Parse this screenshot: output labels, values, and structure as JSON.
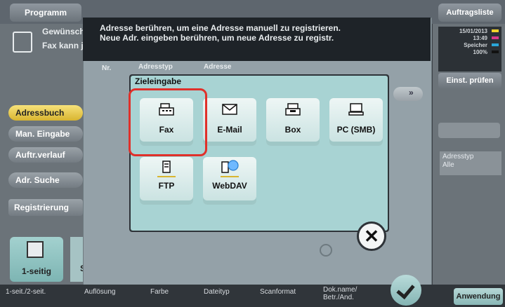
{
  "header": {
    "tab_program": "Programm",
    "tab_jobs": "Auftragsliste"
  },
  "status": {
    "date": "15/01/2013",
    "time": "13:49",
    "memory_label": "Speicher",
    "memory_value": "100%",
    "toner": [
      "Y",
      "M",
      "C",
      "K"
    ]
  },
  "right": {
    "settings_button": "Einst. prüfen",
    "addresstype_label": "Adresstyp",
    "addresstype_value": "Alle"
  },
  "left": {
    "note_line1": "Gewünschte",
    "note_line2": "Fax kann jed",
    "buttons": [
      "Adressbuch",
      "Man. Eingabe",
      "Auftr.verlauf",
      "Adr. Suche"
    ],
    "register_button": "Registrierung",
    "duplex_tile": "1-seitig",
    "mini_tile": "S"
  },
  "dialog": {
    "instruction_line1": "Adresse berühren, um eine Adresse manuell zu registrieren.",
    "instruction_line2": "Neue Adr. eingeben berühren, um neue Adresse zu registr.",
    "col_nr": "Nr.",
    "col_addresstype": "Adresstyp",
    "col_address": "Adresse"
  },
  "popup": {
    "title": "Zieleingabe",
    "tiles": [
      "Fax",
      "E-Mail",
      "Box",
      "PC (SMB)",
      "FTP",
      "WebDAV"
    ],
    "close_glyph": "✕"
  },
  "bottom": {
    "labels": [
      "1-seit./2-seit.",
      "Auflösung",
      "Farbe",
      "Dateityp",
      "Scanformat",
      "Dok.name/",
      "Betr./And."
    ],
    "apply_button": "Anwendung"
  },
  "colors": {
    "accent_yellow": "#d8b530",
    "tile_teal": "#a8d3d3",
    "highlight_red": "#e0302a"
  }
}
